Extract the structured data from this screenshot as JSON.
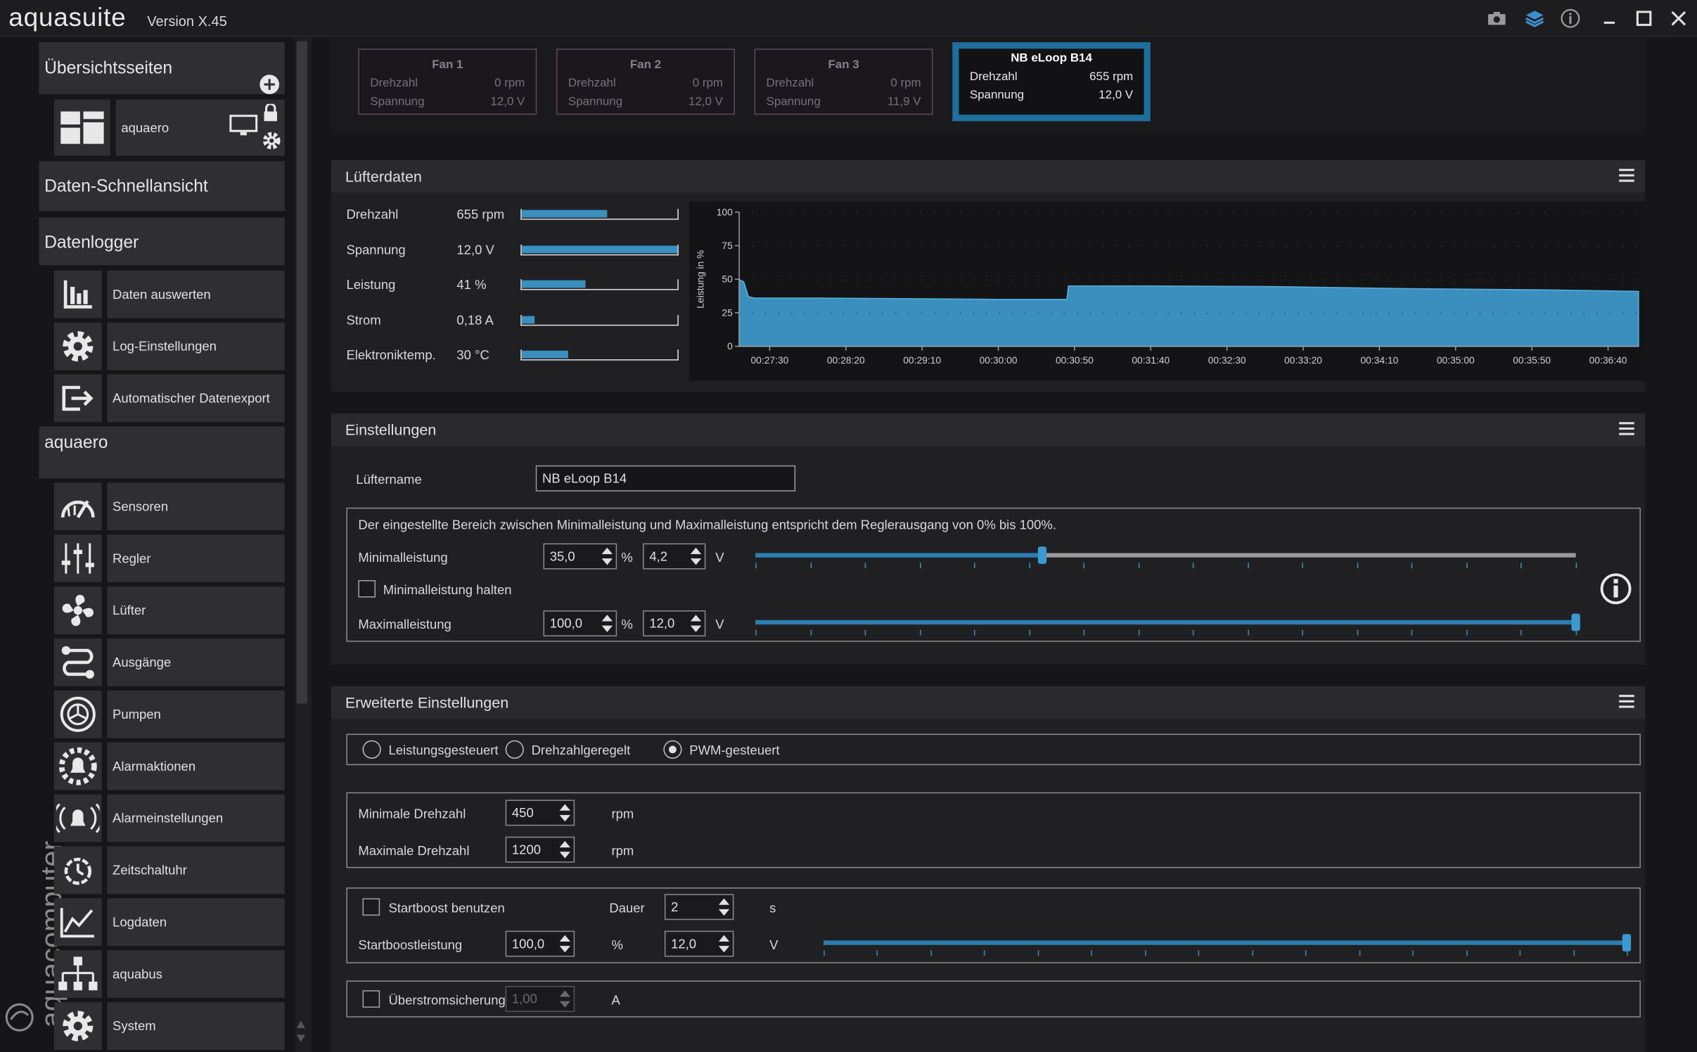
{
  "app": {
    "name": "aquasuite",
    "version": "Version X.45",
    "brand": "aquacomputer"
  },
  "sidebar": {
    "overview_title": "Übersichtsseiten",
    "overview_item": "aquaero",
    "quickview": "Daten-Schnellansicht",
    "datalogger": "Datenlogger",
    "logger_items": [
      "Daten auswerten",
      "Log-Einstellungen",
      "Automatischer Datenexport"
    ],
    "device_title": "aquaero",
    "device_items": [
      "Sensoren",
      "Regler",
      "Lüfter",
      "Ausgänge",
      "Pumpen",
      "Alarmaktionen",
      "Alarmeinstellungen",
      "Zeitschaltuhr",
      "Logdaten",
      "aquabus",
      "System"
    ]
  },
  "fans": [
    {
      "name": "Fan 1",
      "l1": "Drehzahl",
      "v1": "0 rpm",
      "l2": "Spannung",
      "v2": "12,0 V"
    },
    {
      "name": "Fan 2",
      "l1": "Drehzahl",
      "v1": "0 rpm",
      "l2": "Spannung",
      "v2": "12,0 V"
    },
    {
      "name": "Fan 3",
      "l1": "Drehzahl",
      "v1": "0 rpm",
      "l2": "Spannung",
      "v2": "11,9 V"
    },
    {
      "name": "NB eLoop B14",
      "l1": "Drehzahl",
      "v1": "655 rpm",
      "l2": "Spannung",
      "v2": "12,0 V"
    }
  ],
  "fan_data": {
    "title": "Lüfterdaten",
    "rows": [
      {
        "label": "Drehzahl",
        "value": "655 rpm",
        "fill": 0.55
      },
      {
        "label": "Spannung",
        "value": "12,0 V",
        "fill": 1.0
      },
      {
        "label": "Leistung",
        "value": "41 %",
        "fill": 0.41
      },
      {
        "label": "Strom",
        "value": "0,18 A",
        "fill": 0.08
      },
      {
        "label": "Elektroniktemp.",
        "value": "30 °C",
        "fill": 0.3
      }
    ]
  },
  "chart_data": {
    "type": "area",
    "ylabel": "Leistung in %",
    "ylim": [
      0,
      100
    ],
    "yticks": [
      "0",
      "25",
      "50",
      "75",
      "100"
    ],
    "xticks": [
      "00:27:30",
      "00:28:20",
      "00:29:10",
      "00:30:00",
      "00:30:50",
      "00:31:40",
      "00:32:30",
      "00:33:20",
      "00:34:10",
      "00:35:00",
      "00:35:50",
      "00:36:40"
    ],
    "x": [
      "00:27:10",
      "00:27:13",
      "00:27:16",
      "00:27:20",
      "00:28:00",
      "00:29:00",
      "00:30:00",
      "00:30:45",
      "00:30:46",
      "00:31:40",
      "00:33:00",
      "00:34:30",
      "00:36:00",
      "00:37:00"
    ],
    "values": [
      50,
      48,
      37,
      36,
      36,
      35.5,
      35,
      35,
      45,
      45,
      44.5,
      43,
      42,
      41
    ],
    "color": "#3a8fbf",
    "grid": false
  },
  "settings": {
    "title": "Einstellungen",
    "name_label": "Lüftername",
    "name_value": "NB eLoop B14",
    "info": "Der eingestellte Bereich zwischen Minimalleistung und Maximalleistung entspricht dem Reglerausgang von 0% bis 100%.",
    "min_label": "Minimalleistung",
    "min_pct": "35,0",
    "min_volt": "4,2",
    "min_level": 0.35,
    "hold_label": "Minimalleistung halten",
    "max_label": "Maximalleistung",
    "max_pct": "100,0",
    "max_volt": "12,0",
    "max_level": 1.0,
    "pct_unit": "%",
    "volt_unit": "V"
  },
  "advanced": {
    "title": "Erweiterte Einstellungen",
    "modes": [
      "Leistungsgesteuert",
      "Drehzahlgeregelt",
      "PWM-gesteuert"
    ],
    "selected_mode": 2,
    "min_rpm_label": "Minimale Drehzahl",
    "min_rpm": "450",
    "max_rpm_label": "Maximale Drehzahl",
    "max_rpm": "1200",
    "rpm_unit": "rpm",
    "startboost_label": "Startboost benutzen",
    "duration_label": "Dauer",
    "duration_value": "2",
    "duration_unit": "s",
    "boost_label": "Startboostleistung",
    "boost_pct": "100,0",
    "boost_volt": "12,0",
    "boost_level": 1.0,
    "pct_unit": "%",
    "volt_unit": "V",
    "overcurrent_label": "Überstromsicherung",
    "overcurrent_value": "1,00",
    "current_unit": "A"
  }
}
